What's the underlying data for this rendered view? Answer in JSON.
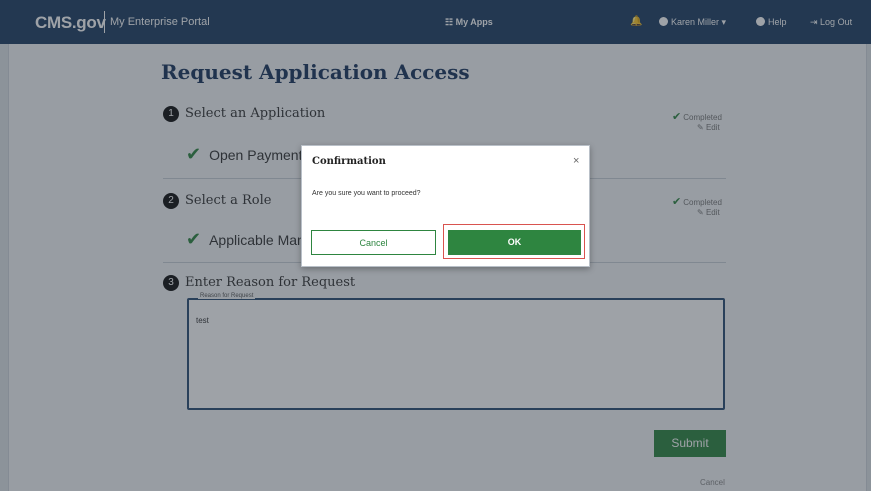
{
  "header": {
    "brand": "CMS.gov",
    "portal": "My Enterprise Portal",
    "myapps": "My Apps",
    "user": "Karen Miller",
    "help": "Help",
    "logout": "Log Out"
  },
  "page": {
    "title": "Request Application Access",
    "steps": [
      {
        "number": "1",
        "title": "Select an Application",
        "done_label": "Open Payments",
        "status": "Completed",
        "edit": "Edit"
      },
      {
        "number": "2",
        "title": "Select a Role",
        "done_label": "Applicable Manufacturer",
        "status": "Completed",
        "edit": "Edit"
      },
      {
        "number": "3",
        "title": "Enter Reason for Request"
      }
    ],
    "reason_label": "Reason for Request",
    "reason_value": "test",
    "submit": "Submit",
    "cancel": "Cancel"
  },
  "modal": {
    "title": "Confirmation",
    "close": "×",
    "message": "Are you sure you want to proceed?",
    "cancel": "Cancel",
    "ok": "OK"
  },
  "colors": {
    "header_bg": "#1f3f63",
    "accent_green": "#2e8540",
    "highlight_red": "#d9534f"
  }
}
